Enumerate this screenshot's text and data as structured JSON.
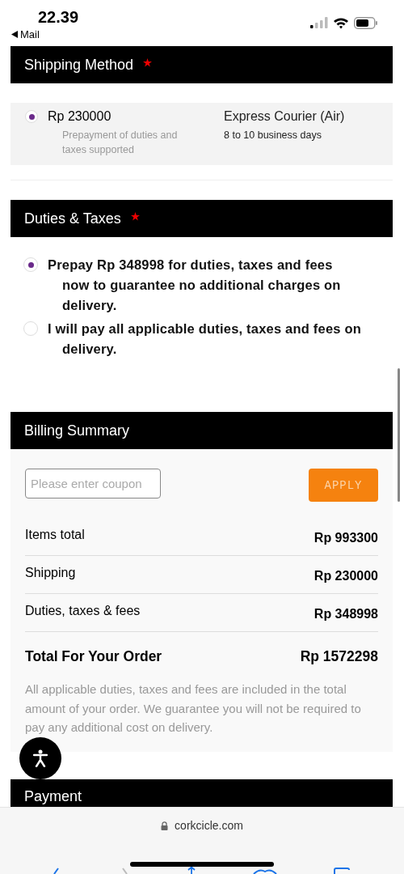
{
  "status_bar": {
    "time": "22.39",
    "back_label": "Mail"
  },
  "shipping_method": {
    "title": "Shipping Method",
    "required": true,
    "options": [
      {
        "price": "Rp 230000",
        "note": "Prepayment of duties and taxes supported",
        "name": "Express Courier (Air)",
        "eta": "8 to 10 business days",
        "selected": true
      }
    ]
  },
  "duties_taxes": {
    "title": "Duties & Taxes",
    "required": true,
    "options": [
      {
        "label": "Prepay Rp 348998 for duties, taxes and fees now to guarantee no additional charges on delivery.",
        "selected": true
      },
      {
        "label": "I will pay all applicable duties, taxes and fees on delivery.",
        "selected": false
      }
    ]
  },
  "billing_summary": {
    "title": "Billing Summary",
    "coupon": {
      "placeholder": "Please enter coupon"
    },
    "apply_button": "APPLY",
    "lines": [
      {
        "label": "Items total",
        "amount": "Rp 993300"
      },
      {
        "label": "Shipping",
        "amount": "Rp 230000"
      },
      {
        "label": "Duties, taxes & fees",
        "amount": "Rp 348998"
      }
    ],
    "total": {
      "label": "Total For Your Order",
      "amount": "Rp 1572298"
    },
    "note": "All applicable duties, taxes and fees are included in the total amount of your order. We guarantee you will not be required to pay any additional cost on delivery."
  },
  "payment": {
    "title": "Payment"
  },
  "browser": {
    "url": "corkcicle.com"
  }
}
